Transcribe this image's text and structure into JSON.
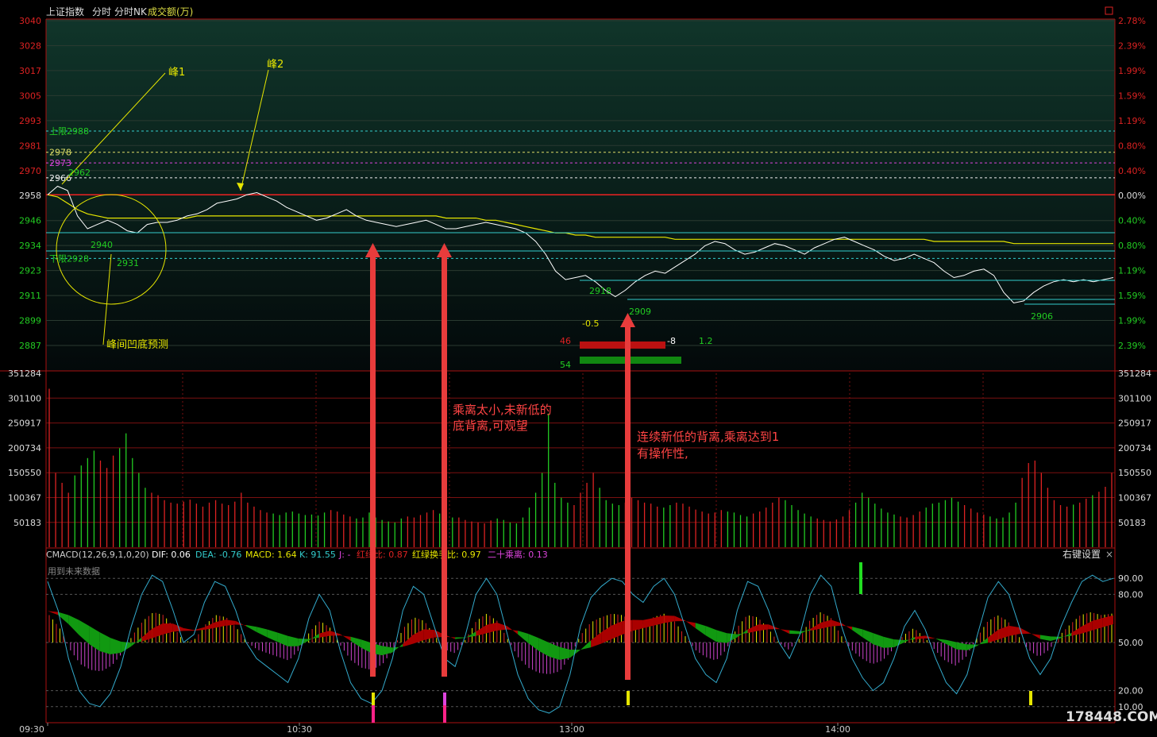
{
  "header": {
    "index_name": "上证指数",
    "tab1": "分时",
    "tab2": "分时NK",
    "volume_label": "成交额(万)"
  },
  "colors": {
    "price_line": "#ffffff",
    "avg_line": "#e6e600",
    "up_red": "#cc0000",
    "down_green": "#00b000",
    "axis_red": "#dd2222",
    "axis_green": "#22cc22",
    "cyan": "#33cccc",
    "panel_bg_top": "#0f2e24",
    "panel_bg_bottom": "#040a0a"
  },
  "chart_data": [
    {
      "type": "line",
      "name": "price",
      "x_labels": [
        "09:30",
        "10:30",
        "13:00",
        "14:00"
      ],
      "y_left_ticks": [
        "3040",
        "3028",
        "3017",
        "3005",
        "2993",
        "2981",
        "2970",
        "2958",
        "2946",
        "2934",
        "2923",
        "2911",
        "2899",
        "2887"
      ],
      "y_right_ticks": [
        "2.78%",
        "2.39%",
        "1.99%",
        "1.59%",
        "1.19%",
        "0.80%",
        "0.40%",
        "0.00%",
        "0.40%",
        "0.80%",
        "1.19%",
        "1.59%",
        "1.99%",
        "2.39%"
      ],
      "prev_close": 2958,
      "ylim": [
        2887,
        3040
      ],
      "price_series": [
        2958,
        2962,
        2960,
        2948,
        2942,
        2944,
        2946,
        2944,
        2941,
        2940,
        2944,
        2945,
        2945,
        2946,
        2948,
        2949,
        2951,
        2954,
        2955,
        2956,
        2958,
        2959,
        2957,
        2955,
        2952,
        2950,
        2948,
        2946,
        2947,
        2949,
        2951,
        2948,
        2946,
        2945,
        2944,
        2943,
        2944,
        2945,
        2946,
        2944,
        2942,
        2942,
        2943,
        2944,
        2945,
        2944,
        2943,
        2942,
        2940,
        2936,
        2930,
        2922,
        2918,
        2919,
        2920,
        2917,
        2913,
        2910,
        2913,
        2917,
        2920,
        2922,
        2921,
        2924,
        2927,
        2930,
        2934,
        2936,
        2935,
        2932,
        2930,
        2931,
        2933,
        2935,
        2934,
        2932,
        2930,
        2933,
        2935,
        2937,
        2938,
        2936,
        2934,
        2932,
        2929,
        2927,
        2928,
        2930,
        2928,
        2926,
        2922,
        2919,
        2920,
        2922,
        2923,
        2920,
        2912,
        2907,
        2908,
        2912,
        2915,
        2917,
        2918,
        2917,
        2918,
        2917,
        2918,
        2919
      ],
      "avg_series": [
        2958,
        2957,
        2954,
        2951,
        2949,
        2948,
        2947,
        2947,
        2947,
        2947,
        2947,
        2947,
        2947,
        2947,
        2947,
        2948,
        2948,
        2948,
        2948,
        2948,
        2948,
        2948,
        2948,
        2948,
        2948,
        2948,
        2948,
        2948,
        2948,
        2948,
        2948,
        2948,
        2948,
        2948,
        2948,
        2948,
        2948,
        2948,
        2948,
        2948,
        2947,
        2947,
        2947,
        2947,
        2946,
        2946,
        2945,
        2944,
        2943,
        2942,
        2941,
        2940,
        2940,
        2939,
        2939,
        2938,
        2938,
        2938,
        2938,
        2938,
        2938,
        2938,
        2938,
        2937,
        2937,
        2937,
        2937,
        2937,
        2937,
        2937,
        2937,
        2937,
        2937,
        2937,
        2937,
        2937,
        2937,
        2937,
        2937,
        2937,
        2937,
        2937,
        2937,
        2937,
        2937,
        2937,
        2937,
        2937,
        2937,
        2936,
        2936,
        2936,
        2936,
        2936,
        2936,
        2936,
        2936,
        2935,
        2935,
        2935,
        2935,
        2935,
        2935,
        2935,
        2935,
        2935,
        2935,
        2935
      ],
      "level_lines": [
        {
          "label": "上限2988",
          "value": 2988,
          "color": "#33cccc"
        },
        {
          "label": "2978",
          "value": 2978,
          "color": "#dddd66"
        },
        {
          "label": "2973",
          "value": 2973,
          "color": "#dd44dd"
        },
        {
          "label": "2966",
          "value": 2966,
          "color": "#eeeeee"
        },
        {
          "label": "下限2928",
          "value": 2928,
          "color": "#33cccc"
        }
      ],
      "point_labels": [
        "2962",
        "2940",
        "2931",
        "2918",
        "2909",
        "2906"
      ],
      "annotations": [
        "峰1",
        "峰2",
        "峰间凹底预测"
      ],
      "indicator_texts": {
        "top": "-0.5",
        "left_top": "46",
        "left_bottom": "54",
        "mid": "-8",
        "right": "1.2"
      }
    },
    {
      "type": "bar",
      "name": "volume",
      "y_ticks": [
        "351284",
        "301100",
        "250917",
        "200734",
        "150550",
        "100367",
        "50183"
      ],
      "ylim": [
        0,
        351284
      ],
      "values": [
        320000,
        150000,
        130000,
        110000,
        145000,
        165000,
        180000,
        195000,
        175000,
        160000,
        185000,
        200000,
        230000,
        180000,
        150000,
        120000,
        110000,
        105000,
        95000,
        90000,
        88000,
        92000,
        96000,
        88000,
        82000,
        90000,
        95000,
        88000,
        85000,
        92000,
        110000,
        90000,
        82000,
        75000,
        70000,
        68000,
        65000,
        70000,
        72000,
        68000,
        65000,
        66000,
        64000,
        70000,
        75000,
        72000,
        66000,
        62000,
        58000,
        60000,
        70000,
        60000,
        55000,
        52000,
        50000,
        58000,
        62000,
        60000,
        65000,
        70000,
        75000,
        68000,
        64000,
        60000,
        60000,
        55000,
        52000,
        50000,
        48000,
        54000,
        58000,
        55000,
        50000,
        48000,
        60000,
        80000,
        110000,
        150000,
        270000,
        130000,
        100000,
        90000,
        85000,
        110000,
        130000,
        150000,
        120000,
        95000,
        88000,
        85000,
        90000,
        100000,
        95000,
        90000,
        88000,
        82000,
        80000,
        85000,
        90000,
        88000,
        82000,
        76000,
        72000,
        68000,
        70000,
        75000,
        72000,
        70000,
        65000,
        62000,
        68000,
        72000,
        80000,
        90000,
        100000,
        95000,
        85000,
        75000,
        68000,
        62000,
        58000,
        55000,
        52000,
        56000,
        62000,
        75000,
        90000,
        110000,
        100000,
        88000,
        78000,
        70000,
        66000,
        62000,
        60000,
        65000,
        72000,
        80000,
        88000,
        90000,
        95000,
        100000,
        92000,
        85000,
        78000,
        70000,
        66000,
        62000,
        58000,
        60000,
        70000,
        90000,
        140000,
        170000,
        175000,
        150000,
        120000,
        95000,
        85000,
        82000,
        86000,
        90000,
        98000,
        105000,
        112000,
        122000,
        150000
      ]
    },
    {
      "type": "line",
      "name": "CMACD",
      "y_ticks": [
        "90.00",
        "80.00",
        "50.00",
        "20.00",
        "10.00"
      ],
      "ylim": [
        0,
        100
      ],
      "legend": {
        "name": "CMACD(12,26,9,1,0,20)",
        "dif": "DIF: 0.06",
        "dea": "DEA: -0.76",
        "macd": "MACD: 1.64",
        "k": "K: 91.55",
        "j": "J: -",
        "ratio1": "红绿比: 0.87",
        "ratio2": "红绿换手比: 0.97",
        "ratio3": "二十乘离: 0.13"
      },
      "settings_label": "右键设置",
      "future_data_label": "用到未来数据",
      "k_series": [
        88,
        70,
        40,
        20,
        12,
        10,
        18,
        35,
        60,
        80,
        92,
        88,
        70,
        50,
        55,
        75,
        88,
        85,
        70,
        50,
        40,
        35,
        30,
        25,
        40,
        65,
        80,
        70,
        45,
        25,
        15,
        12,
        20,
        40,
        70,
        85,
        80,
        60,
        40,
        35,
        55,
        80,
        90,
        80,
        55,
        30,
        15,
        8,
        6,
        10,
        30,
        60,
        78,
        85,
        90,
        88,
        80,
        75,
        85,
        90,
        80,
        60,
        40,
        30,
        25,
        40,
        70,
        88,
        85,
        70,
        50,
        40,
        55,
        80,
        92,
        85,
        60,
        40,
        28,
        20,
        25,
        40,
        60,
        70,
        58,
        40,
        25,
        18,
        30,
        55,
        78,
        88,
        80,
        60,
        40,
        30,
        40,
        60,
        75,
        88,
        92,
        88,
        90
      ]
    }
  ],
  "annotations": {
    "peak1": "峰1",
    "peak2": "峰2",
    "valley_forecast": "峰间凹底预测",
    "note1_line1": "乘离太小,未新低的",
    "note1_line2": "底背离,可观望",
    "note2_line1": "连续新低的背离,乘离达到1",
    "note2_line2": "有操作性,"
  },
  "watermark": "178448.COM"
}
